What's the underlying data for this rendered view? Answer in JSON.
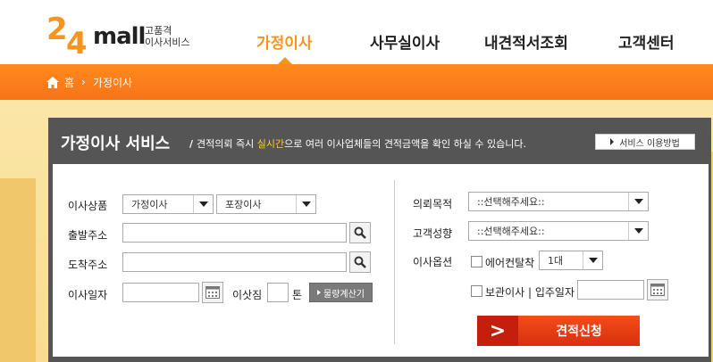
{
  "logo": {
    "number_2": "2",
    "number_4": "4",
    "wordmark": "mall",
    "tagline_line1": "고품격",
    "tagline_line2": "이사서비스"
  },
  "nav": [
    {
      "label": "가정이사",
      "active": true
    },
    {
      "label": "사무실이사",
      "active": false
    },
    {
      "label": "내견적서조회",
      "active": false
    },
    {
      "label": "고객센터",
      "active": false
    }
  ],
  "breadcrumb": {
    "home": "홈",
    "current": "가정이사"
  },
  "panel": {
    "title": "가정이사 서비스",
    "desc_prefix": "/",
    "desc_before": "견적의뢰 즉시 ",
    "desc_highlight": "실시간",
    "desc_after": "으로 여러 이사업체들의 견적금액을 확인 하실 수 있습니다.",
    "guide_button": "서비스 이용방법"
  },
  "form_left": {
    "product_label": "이사상품",
    "product_type_value": "가정이사",
    "packing_value": "포장이사",
    "departure_label": "출발주소",
    "arrival_label": "도착주소",
    "date_label": "이사일자",
    "load_label": "이삿짐",
    "ton_unit": "톤",
    "calc_button": "물량계산기"
  },
  "form_right": {
    "purpose_label": "의뢰목적",
    "purpose_value": "::선택해주세요::",
    "customer_label": "고객성향",
    "customer_value": "::선택해주세요::",
    "option_label": "이사옵션",
    "aircon_label": "에어컨탈착",
    "aircon_count": "1대",
    "storage_label": "보관이사 | 입주일자",
    "submit_arrow": ">",
    "submit_label": "견적신청"
  },
  "colors": {
    "accent": "#f7941d",
    "panel_bg": "#555555",
    "submit_red": "#e63f14",
    "highlight": "#ffd400"
  }
}
